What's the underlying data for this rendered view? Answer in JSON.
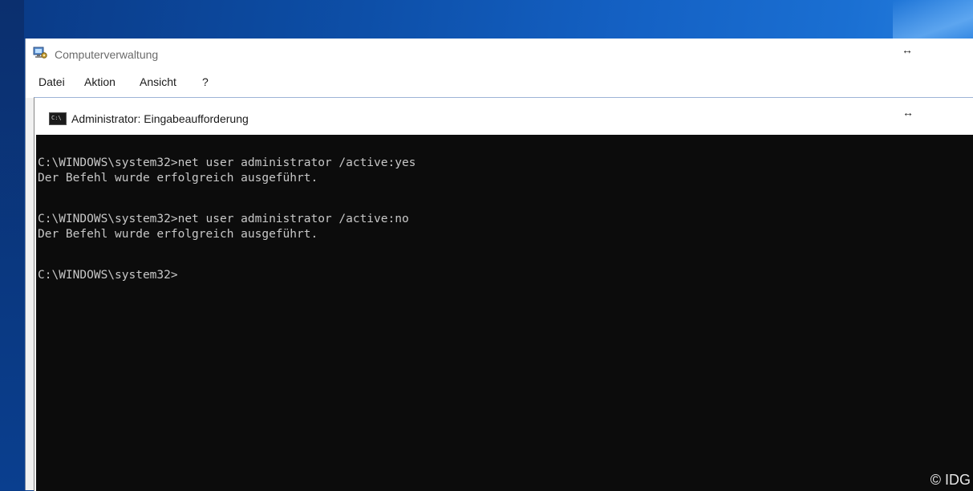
{
  "background_window": {
    "title": "Computerverwaltung",
    "app_icon": "computer-management-icon",
    "resize_glyph": "↔",
    "menu": [
      {
        "label": "Datei"
      },
      {
        "label": "Aktion"
      },
      {
        "label": "Ansicht"
      },
      {
        "label": "?"
      }
    ]
  },
  "console_window": {
    "title": "Administrator: Eingabeaufforderung",
    "icon": "command-prompt-icon",
    "icon_text": "C:\\",
    "resize_glyph": "↔",
    "lines": [
      "C:\\WINDOWS\\system32>net user administrator /active:yes",
      "Der Befehl wurde erfolgreich ausgeführt.",
      "C:\\WINDOWS\\system32>net user administrator /active:no",
      "Der Befehl wurde erfolgreich ausgeführt.",
      "C:\\WINDOWS\\system32>"
    ]
  },
  "watermark": "© IDG",
  "colors": {
    "console_background": "#0c0c0c",
    "console_text": "#c8c8c8",
    "desktop_blue": "#0d4fa8"
  }
}
